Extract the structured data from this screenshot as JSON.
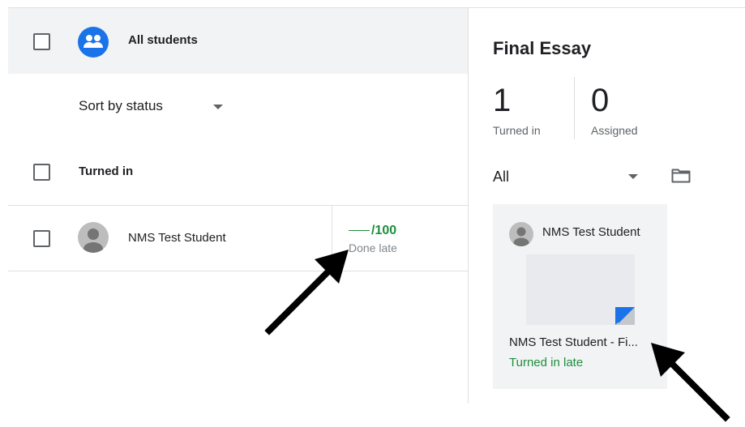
{
  "student_list": {
    "all_students_label": "All students",
    "sort_label": "Sort by status",
    "section_label": "Turned in",
    "students": [
      {
        "name": "NMS Test Student",
        "grade_max": "/100",
        "status": "Done late"
      }
    ]
  },
  "assignment_panel": {
    "title": "Final Essay",
    "stats": {
      "turned_in_count": "1",
      "turned_in_label": "Turned in",
      "assigned_count": "0",
      "assigned_label": "Assigned"
    },
    "filter_label": "All",
    "card": {
      "student_name": "NMS Test Student",
      "file_name": "NMS Test Student - Fi...",
      "status": "Turned in late"
    }
  },
  "colors": {
    "accent_blue": "#1a73e8",
    "status_green": "#1e8e3e",
    "header_bg": "#f1f3f4"
  },
  "icons": [
    "checkbox",
    "people-group-icon",
    "dropdown-caret-icon",
    "avatar-icon",
    "folder-icon",
    "doc-thumbnail",
    "annotation-arrow"
  ]
}
